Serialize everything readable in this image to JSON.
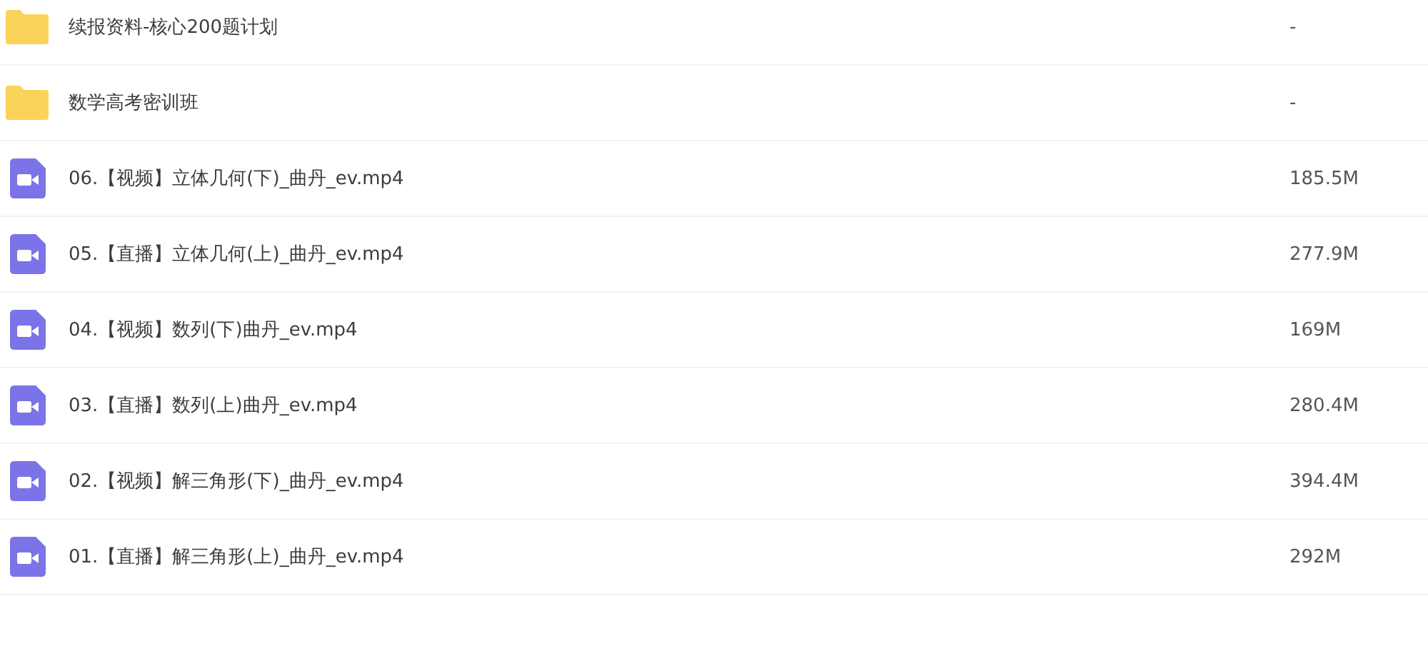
{
  "files": [
    {
      "kind": "folder",
      "name": "续报资料-核心200题计划",
      "size": "-"
    },
    {
      "kind": "folder",
      "name": "数学高考密训班",
      "size": "-"
    },
    {
      "kind": "video",
      "name": "06.【视频】立体几何(下)_曲丹_ev.mp4",
      "size": "185.5M"
    },
    {
      "kind": "video",
      "name": "05.【直播】立体几何(上)_曲丹_ev.mp4",
      "size": "277.9M"
    },
    {
      "kind": "video",
      "name": "04.【视频】数列(下)曲丹_ev.mp4",
      "size": "169M"
    },
    {
      "kind": "video",
      "name": "03.【直播】数列(上)曲丹_ev.mp4",
      "size": "280.4M"
    },
    {
      "kind": "video",
      "name": "02.【视频】解三角形(下)_曲丹_ev.mp4",
      "size": "394.4M"
    },
    {
      "kind": "video",
      "name": "01.【直播】解三角形(上)_曲丹_ev.mp4",
      "size": "292M"
    }
  ]
}
